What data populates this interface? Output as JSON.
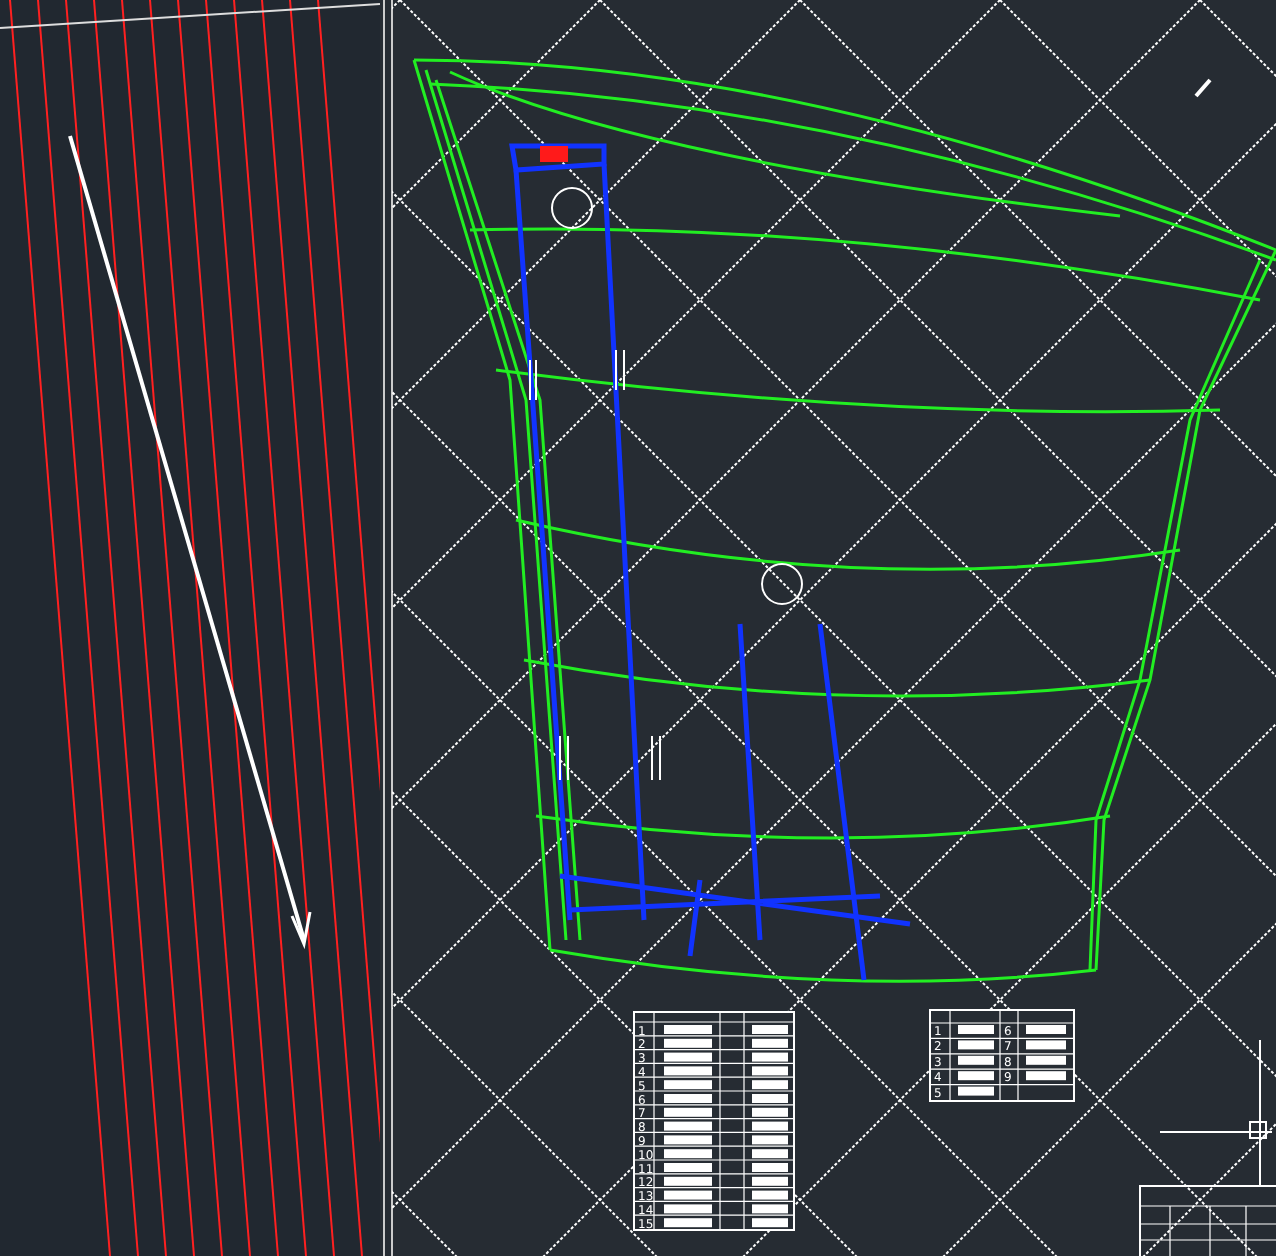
{
  "equipment_table": {
    "row_numbers": [
      "1",
      "2",
      "3",
      "4",
      "5",
      "6",
      "7",
      "8",
      "9",
      "10",
      "11",
      "12",
      "13",
      "14",
      "15"
    ]
  },
  "material_table": {
    "left_numbers": [
      "1",
      "2",
      "3",
      "4",
      "5"
    ],
    "right_numbers": [
      "6",
      "7",
      "8",
      "9"
    ]
  }
}
